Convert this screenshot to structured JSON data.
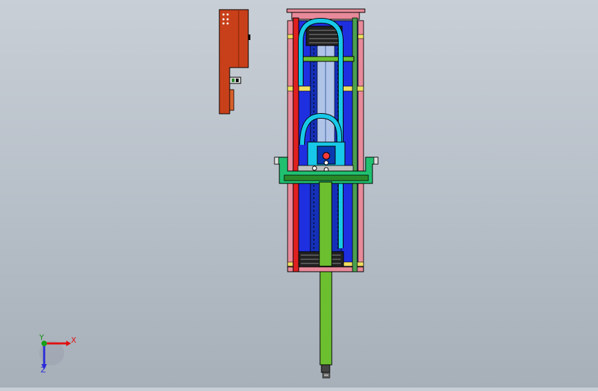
{
  "app": {
    "view": "cad-3d-viewport"
  },
  "triad": {
    "x_label": "X",
    "y_label": "Y",
    "z_label": "Z",
    "x_color": "#e01010",
    "y_color": "#18a018",
    "z_color": "#2a2ad8"
  },
  "model": {
    "frame_color": "#1e2fe0",
    "rail_color": "#e02020",
    "hose_color": "#18c8e8",
    "bracket_color": "#20c070",
    "shaft_color": "#6cc030",
    "plate_color": "#c8401a"
  }
}
